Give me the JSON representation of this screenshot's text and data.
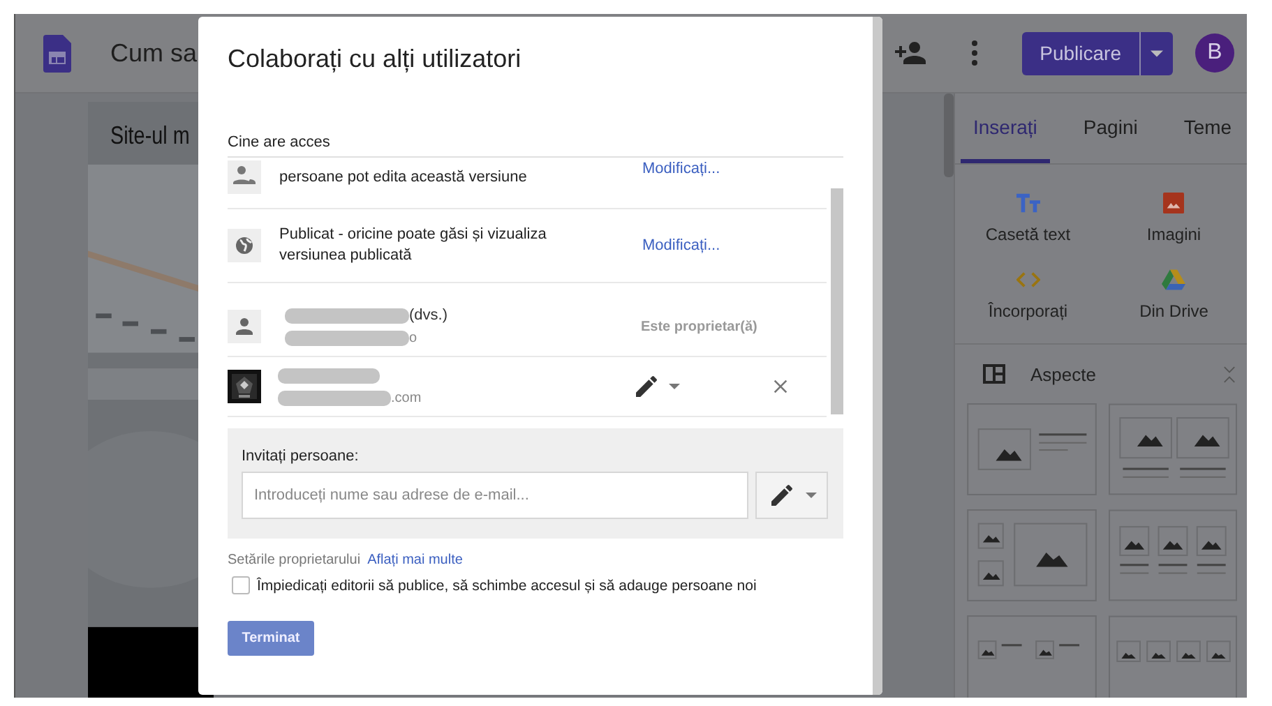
{
  "app": {
    "doc_title": "Cum sa",
    "publish_button": "Publicare",
    "avatar": "B",
    "page_title": "Site-ul m",
    "tabs": [
      {
        "label": "Inserați",
        "selected": true
      },
      {
        "label": "Pagini",
        "selected": false
      },
      {
        "label": "Teme",
        "selected": false
      }
    ],
    "insert_items": [
      {
        "label": "Casetă text",
        "kind": "text"
      },
      {
        "label": "Imagini",
        "kind": "images"
      },
      {
        "label": "Încorporați",
        "kind": "embed"
      },
      {
        "label": "Din Drive",
        "kind": "drive"
      }
    ],
    "layouts_title": "Aspecte"
  },
  "dialog": {
    "title": "Colaborați cu alți utilizatori",
    "access_heading": "Cine are acces",
    "access_rows": [
      {
        "kind": "link",
        "text": "persoane pot edita această versiune",
        "action": "Modificați..."
      },
      {
        "kind": "public",
        "text": "Publicat - oricine poate găsi și vizualiza versiunea publicată",
        "action": "Modificați..."
      },
      {
        "kind": "owner",
        "name_suffix": "(dvs.)",
        "email_suffix": "o",
        "role": "Este proprietar(ă)"
      },
      {
        "kind": "editor",
        "email_suffix": ".com"
      }
    ],
    "invite_label": "Invitați persoane:",
    "invite_placeholder": "Introduceți nume sau adrese de e-mail...",
    "owner_settings": "Setările proprietarului",
    "learn_more": "Aflați mai multe",
    "restrict_checkbox": {
      "label": "Împiedicați editorii să publice, să schimbe accesul și să adauge persoane noi",
      "checked": false
    },
    "done_button": "Terminat"
  }
}
